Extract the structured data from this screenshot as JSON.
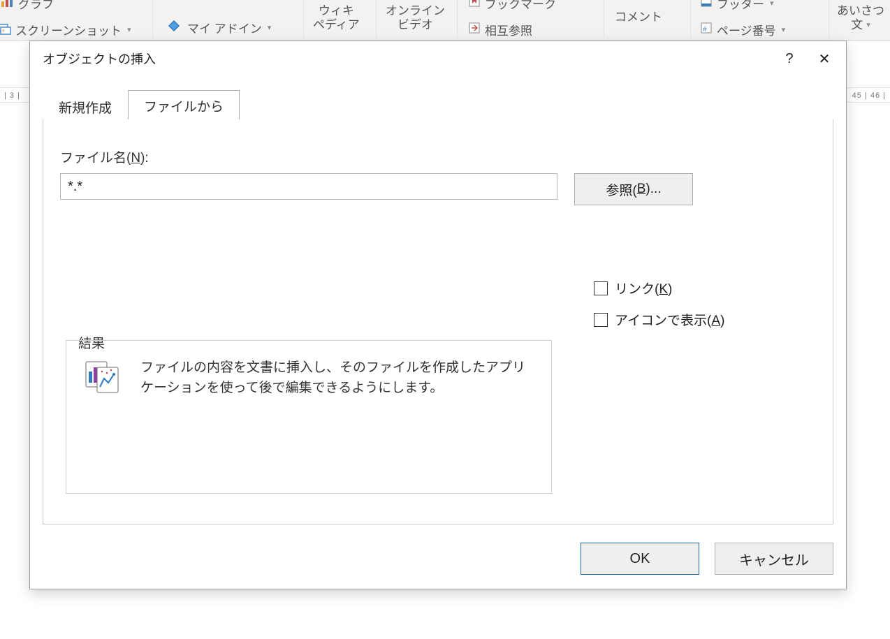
{
  "ribbon": {
    "graph_label": "グラフ",
    "screenshot_label": "スクリーンショット",
    "myaddins_label": "マイ アドイン",
    "wiki1": "ウィキ",
    "wiki2": "ペディア",
    "online1": "オンライン",
    "online2": "ビデオ",
    "bookmark_label": "ブックマーク",
    "crossref_label": "相互参照",
    "comment_label": "コメント",
    "footer_label": "フッター",
    "pagenum_label": "ページ番号",
    "aisatsu1": "あいさつ",
    "aisatsu2": "文"
  },
  "ruler": {
    "left": "| 3 |",
    "right": "45 | 46 |"
  },
  "dialog": {
    "title": "オブジェクトの挿入",
    "help_tooltip": "?",
    "close_tooltip": "✕",
    "tabs": {
      "new": "新規作成",
      "file": "ファイルから"
    },
    "filename_label_pre": "ファイル名(",
    "filename_label_u": "N",
    "filename_label_post": "):",
    "filename_value": "*.*",
    "browse_pre": "参照(",
    "browse_u": "B",
    "browse_post": ")...",
    "link_pre": "リンク(",
    "link_u": "K",
    "link_post": ")",
    "iconshow_pre": "アイコンで表示(",
    "iconshow_u": "A",
    "iconshow_post": ")",
    "result_legend": "結果",
    "result_text": "ファイルの内容を文書に挿入し、そのファイルを作成したアプリケーションを使って後で編集できるようにします。",
    "ok": "OK",
    "cancel": "キャンセル"
  }
}
